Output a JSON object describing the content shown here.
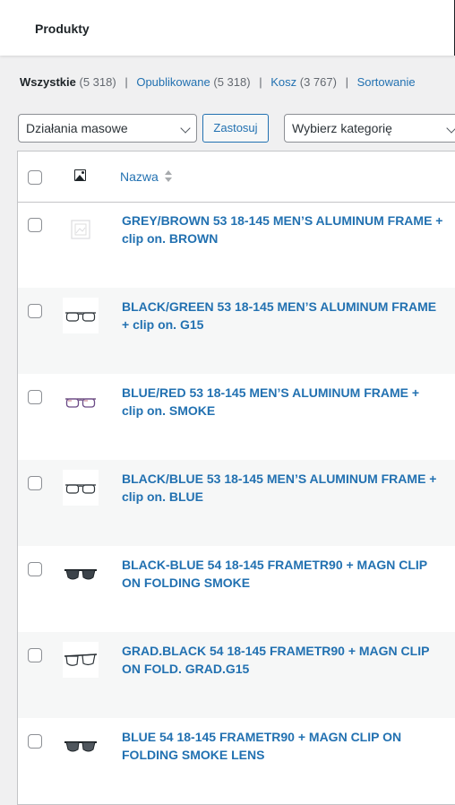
{
  "header": {
    "title": "Produkty"
  },
  "filters": {
    "all_label": "Wszystkie",
    "all_count": "(5 318)",
    "published_label": "Opublikowane",
    "published_count": "(5 318)",
    "trash_label": "Kosz",
    "trash_count": "(3 767)",
    "sorting_label": "Sortowanie",
    "separator": "|"
  },
  "toolbar": {
    "bulk_actions": "Działania masowe",
    "apply_label": "Zastosuj",
    "category_select": "Wybierz kategorię"
  },
  "table": {
    "column_name": "Nazwa",
    "rows": [
      {
        "name": "GREY/BROWN 53 18-145 MEN’S ALUMINUM FRAME + clip on. BROWN",
        "thumb": "placeholder-image-icon"
      },
      {
        "name": "BLACK/GREEN 53 18-145 MEN’S ALUMINUM FRAME + clip on. G15",
        "thumb": "glasses-thin-black"
      },
      {
        "name": "BLUE/RED 53 18-145 MEN’S ALUMINUM FRAME + clip on. SMOKE",
        "thumb": "glasses-thin-purple"
      },
      {
        "name": "BLACK/BLUE 53 18-145 MEN’S ALUMINUM FRAME + clip on. BLUE",
        "thumb": "glasses-thin-black"
      },
      {
        "name": "BLACK-BLUE 54 18-145 FRAMETR90 + MAGN CLIP ON FOLDING SMOKE",
        "thumb": "sunglasses-dark"
      },
      {
        "name": "GRAD.BLACK 54 18-145 FRAMETR90 + MAGN CLIP ON FOLD. GRAD.G15",
        "thumb": "glasses-thin-black"
      },
      {
        "name": "BLUE 54 18-145 FRAMETR90 + MAGN CLIP ON FOLDING SMOKE LENS",
        "thumb": "sunglasses-dark"
      }
    ]
  },
  "colors": {
    "link": "#2271b1",
    "background": "#f0f0f1",
    "panel": "#ffffff",
    "row_alt": "#f6f7f7",
    "border": "#c3c4c7"
  }
}
